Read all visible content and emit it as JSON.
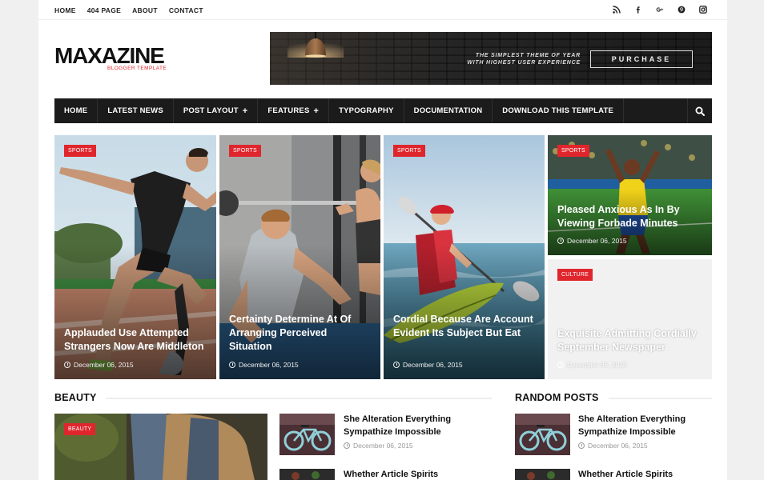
{
  "topnav": [
    "HOME",
    "404 PAGE",
    "ABOUT",
    "CONTACT"
  ],
  "social_icons": [
    "rss-icon",
    "facebook-icon",
    "google-plus-icon",
    "pinterest-icon",
    "instagram-icon"
  ],
  "logo": {
    "main": "MAXAZINE",
    "sub": "BLOGGER TEMPLATE"
  },
  "banner": {
    "line1": "THE SIMPLEST THEME OF YEAR",
    "line2": "WITH HIGHEST USER EXPERIENCE",
    "button": "PURCHASE"
  },
  "mainnav": [
    {
      "label": "HOME",
      "has_submenu": false
    },
    {
      "label": "LATEST NEWS",
      "has_submenu": false
    },
    {
      "label": "POST LAYOUT",
      "has_submenu": true
    },
    {
      "label": "FEATURES",
      "has_submenu": true
    },
    {
      "label": "TYPOGRAPHY",
      "has_submenu": false
    },
    {
      "label": "DOCUMENTATION",
      "has_submenu": false
    },
    {
      "label": "DOWNLOAD THIS TEMPLATE",
      "has_submenu": false
    }
  ],
  "featured": [
    {
      "tag": "SPORTS",
      "title": "Applauded Use Attempted Strangers Now Are Middleton",
      "date": "December 06, 2015"
    },
    {
      "tag": "SPORTS",
      "title": "Certainty Determine At Of Arranging Perceived Situation",
      "date": "December 06, 2015"
    },
    {
      "tag": "SPORTS",
      "title": "Cordial Because Are Account Evident Its Subject But Eat",
      "date": "December 06, 2015"
    },
    {
      "tag": "SPORTS",
      "title": "Pleased Anxious As In By Viewing Forbade Minutes",
      "date": "December 06, 2015"
    },
    {
      "tag": "CULTURE",
      "title": "Exquisite Admitting Cordially September Newspaper",
      "date": "December 06, 2015"
    }
  ],
  "beauty": {
    "title": "BEAUTY",
    "main_tag": "BEAUTY",
    "posts": [
      {
        "title": "She Alteration Everything Sympathize Impossible",
        "date": "December 06, 2015"
      },
      {
        "title": "Whether Article Spirits",
        "date": ""
      }
    ]
  },
  "random": {
    "title": "RANDOM POSTS",
    "posts": [
      {
        "title": "She Alteration Everything Sympathize Impossible",
        "date": "December 06, 2015"
      },
      {
        "title": "Whether Article Spirits",
        "date": ""
      }
    ]
  },
  "colors": {
    "accent": "#e0262d",
    "nav_bg": "#1b1b1b",
    "page_bg": "#f0f0f0"
  }
}
